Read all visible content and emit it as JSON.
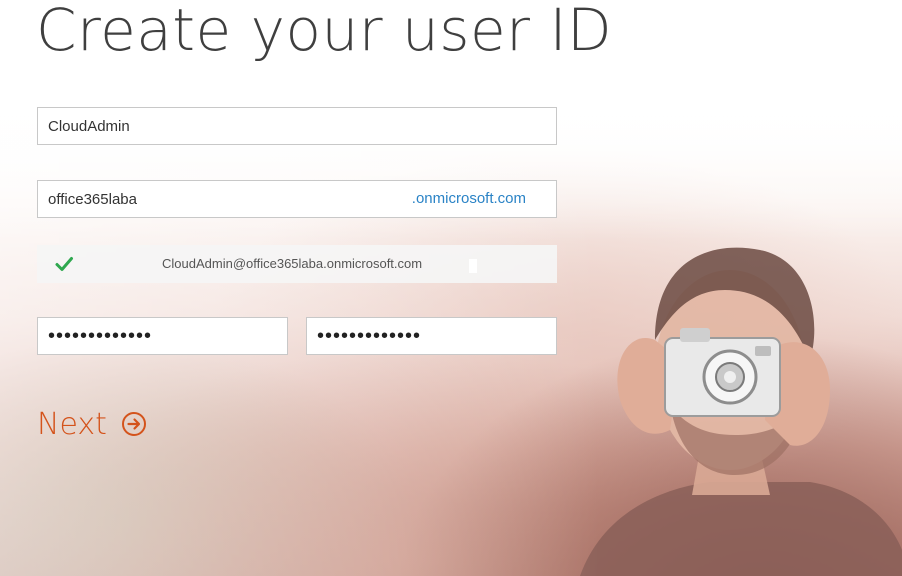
{
  "page": {
    "title": "Create your user ID"
  },
  "form": {
    "user_id_value": "CloudAdmin",
    "domain_prefix_value": "office365laba",
    "domain_suffix": ".onmicrosoft.com",
    "availability_text": "CloudAdmin@office365laba.onmicrosoft.com",
    "availability_status": "available",
    "password_value": "•••••••••••••",
    "confirm_password_value": "•••••••••••••"
  },
  "actions": {
    "next_label": "Next"
  },
  "colors": {
    "accent_orange": "#d4531b",
    "link_blue": "#2a83c6",
    "check_green": "#2fa84f",
    "title_gray": "#3f3f3f"
  },
  "icons": {
    "availability": "checkmark-icon",
    "next": "arrow-right-circle-icon"
  }
}
